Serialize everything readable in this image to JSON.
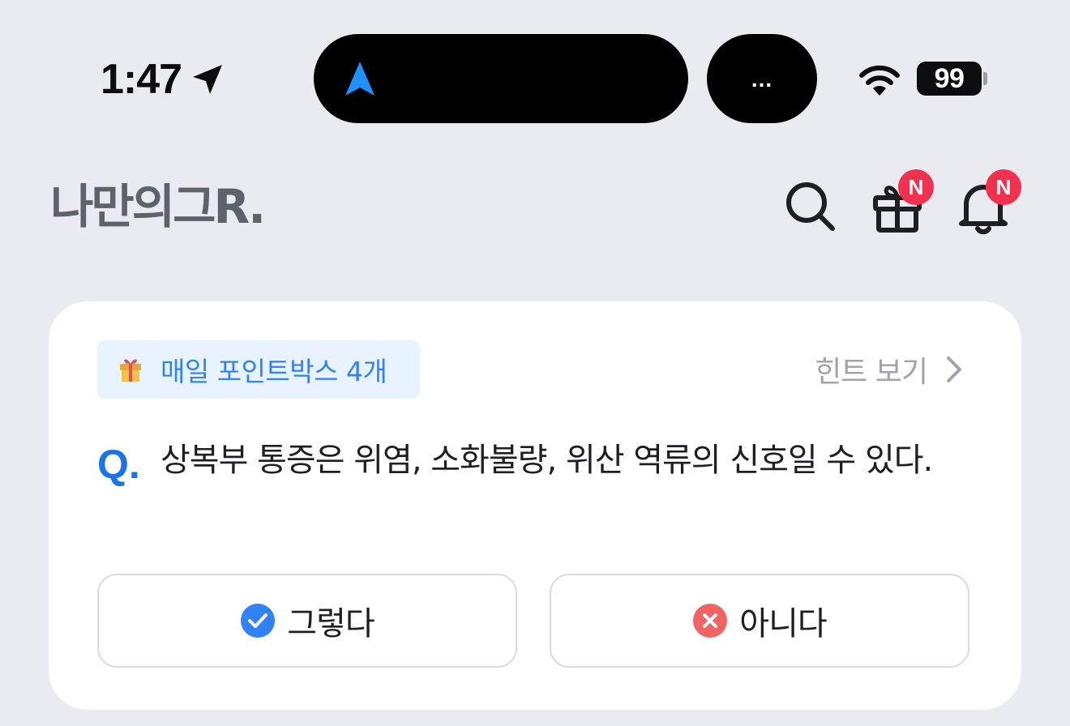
{
  "status_bar": {
    "time": "1:47",
    "island_more": "...",
    "battery": "99",
    "icons": [
      "location-arrow-icon",
      "navigation-arrow-icon",
      "wifi-icon",
      "battery-icon"
    ]
  },
  "header": {
    "logo": "나만의그R.",
    "gift_badge": "N",
    "bell_badge": "N",
    "icons": [
      "search-icon",
      "gift-icon",
      "bell-icon"
    ]
  },
  "quiz": {
    "point_chip": "매일 포인트박스 4개",
    "hint_link": "힌트 보기",
    "q_mark": "Q.",
    "question": "상복부 통증은 위염, 소화불량, 위산 역류의 신호일 수 있다.",
    "answer_yes": "그렇다",
    "answer_no": "아니다"
  },
  "colors": {
    "background": "#E9EBF0",
    "card": "#FFFFFF",
    "accent_blue": "#3182F6",
    "badge_red": "#F1314E",
    "no_red": "#F26464"
  }
}
